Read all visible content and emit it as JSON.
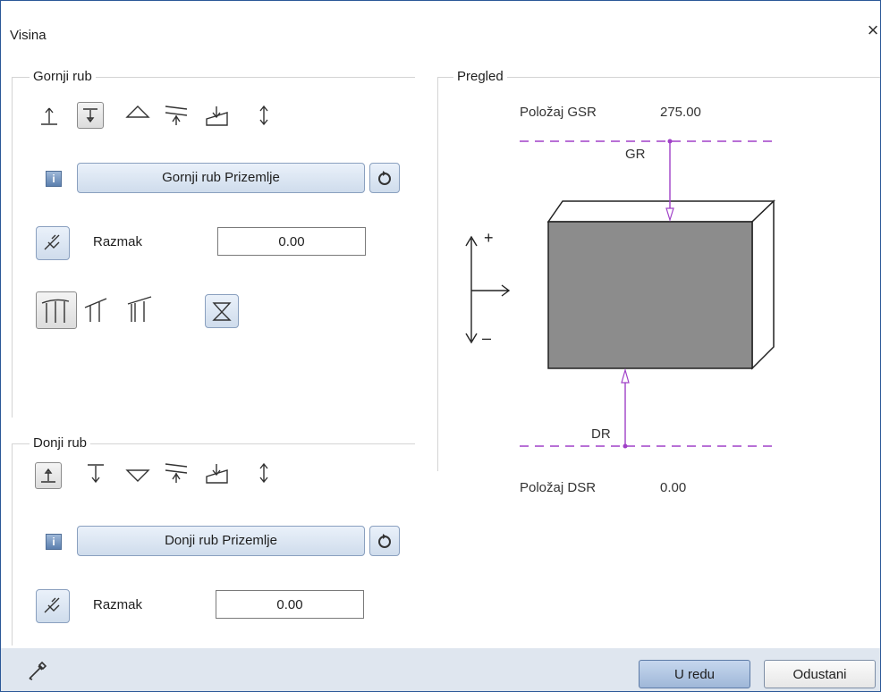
{
  "window": {
    "title": "Visina",
    "close_glyph": "×"
  },
  "top_edge": {
    "group_label": "Gornji rub",
    "reference_button": "Gornji rub Prizemlje",
    "info_glyph": "i",
    "distance_label": "Razmak",
    "distance_value": "0.00",
    "icons": [
      "align-top-edge-icon",
      "align-below-edge-icon",
      "triangle-icon",
      "roof-plane-icon",
      "slope-icon",
      "up-down-icon"
    ]
  },
  "bottom_edge": {
    "group_label": "Donji rub",
    "reference_button": "Donji rub Prizemlje",
    "info_glyph": "i",
    "distance_label": "Razmak",
    "distance_value": "0.00"
  },
  "preview": {
    "group_label": "Pregled",
    "gsr_label": "Položaj GSR",
    "gsr_value": "275.00",
    "gr_label": "GR",
    "dr_label": "DR",
    "dsr_label": "Položaj DSR",
    "dsr_value": "0.00",
    "plus": "+",
    "minus": "–",
    "accent": "#a040c8"
  },
  "footer": {
    "ok_label": "U redu",
    "cancel_label": "Odustani"
  }
}
